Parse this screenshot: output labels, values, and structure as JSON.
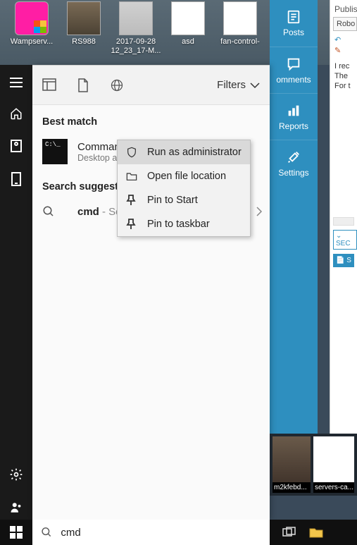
{
  "desktop": {
    "icons": [
      {
        "label": "Wampserv..."
      },
      {
        "label": "RS988"
      },
      {
        "label": "2017-09-28 12_23_17-M..."
      },
      {
        "label": "asd"
      },
      {
        "label": "fan-control-"
      }
    ]
  },
  "blue_rail": {
    "items": [
      {
        "label": "Posts"
      },
      {
        "label": "omments"
      },
      {
        "label": "Reports"
      },
      {
        "label": "Settings"
      }
    ]
  },
  "right_panel": {
    "top": "Publis",
    "tab": "Robo",
    "lines": [
      "I rec",
      "The",
      "For t"
    ],
    "badge": "SEC",
    "button": "S"
  },
  "search": {
    "filters_label": "Filters",
    "best_match": "Best match",
    "result": {
      "title": "Command P",
      "subtitle": "Desktop ap"
    },
    "suggest_header": "Search suggestion",
    "suggest_term": "cmd",
    "suggest_tail": " - See we",
    "input_value": "cmd"
  },
  "context_menu": {
    "items": [
      "Run as administrator",
      "Open file location",
      "Pin to Start",
      "Pin to taskbar"
    ]
  },
  "thumbs": {
    "a": "m2kfebd...",
    "b": "servers-ca..."
  }
}
